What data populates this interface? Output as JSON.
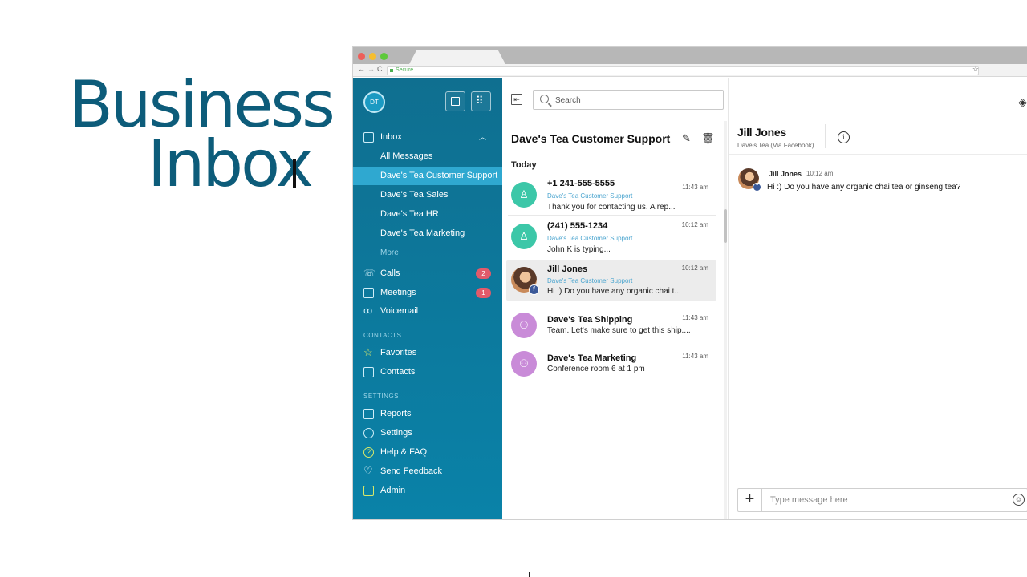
{
  "hero": {
    "line1": "Business",
    "line2": "Inbox"
  },
  "browser": {
    "url_label": "Secure",
    "nav_back": "←",
    "nav_forward": "→",
    "nav_reload": "C",
    "bookmark_star": "☆",
    "traffic_colors": [
      "#ee5f5a",
      "#f6be30",
      "#5dc93a"
    ]
  },
  "sidebar": {
    "avatar_initials": "DT",
    "inbox_label": "Inbox",
    "inbox_items": [
      "All Messages",
      "Dave's Tea Customer Support",
      "Dave's Tea Sales",
      "Dave's Tea HR",
      "Dave's Tea Marketing",
      "More"
    ],
    "main_items": [
      {
        "label": "Calls",
        "badge": "2"
      },
      {
        "label": "Meetings",
        "badge": "1"
      },
      {
        "label": "Voicemail",
        "badge": ""
      }
    ],
    "contacts_header": "CONTACTS",
    "contacts_items": [
      "Favorites",
      "Contacts"
    ],
    "settings_header": "SETTINGS",
    "settings_items": [
      "Reports",
      "Settings",
      "Help & FAQ",
      "Send Feedback",
      "Admin"
    ],
    "accent_color": "#0f6f90",
    "badge_color": "#e25a6a"
  },
  "list": {
    "search_placeholder": "Search",
    "title": "Dave's Tea Customer Support",
    "day_header": "Today",
    "conversations": [
      {
        "name": "+1 241-555-5555",
        "source": "Dave's Tea Customer Support",
        "preview": "Thank you for contacting us. A rep...",
        "time": "11:43 am"
      },
      {
        "name": "(241) 555-1234",
        "source": "Dave's Tea Customer Support",
        "preview": "John K is typing...",
        "time": "10:12 am"
      },
      {
        "name": "Jill Jones",
        "source": "Dave's Tea Customer Support",
        "preview": "Hi :) Do you have any organic chai t...",
        "time": "10:12 am"
      },
      {
        "name": "Dave's Tea Shipping",
        "source": "",
        "preview": "Team.  Let's make sure to get this ship....",
        "time": "11:43 am"
      },
      {
        "name": "Dave's Tea Marketing",
        "source": "",
        "preview": "Conference room 6 at 1 pm",
        "time": "11:43 am"
      }
    ]
  },
  "detail": {
    "contact_name": "Jill Jones",
    "contact_sub": "Dave's Tea (Via Facebook)",
    "info_glyph": "i",
    "message": {
      "sender": "Jill Jones",
      "time": "10:12 am",
      "text": "Hi :) Do you have any organic chai tea or ginseng tea?"
    },
    "composer_placeholder": "Type message here",
    "plus_glyph": "+",
    "emoji_glyph": "☺"
  }
}
